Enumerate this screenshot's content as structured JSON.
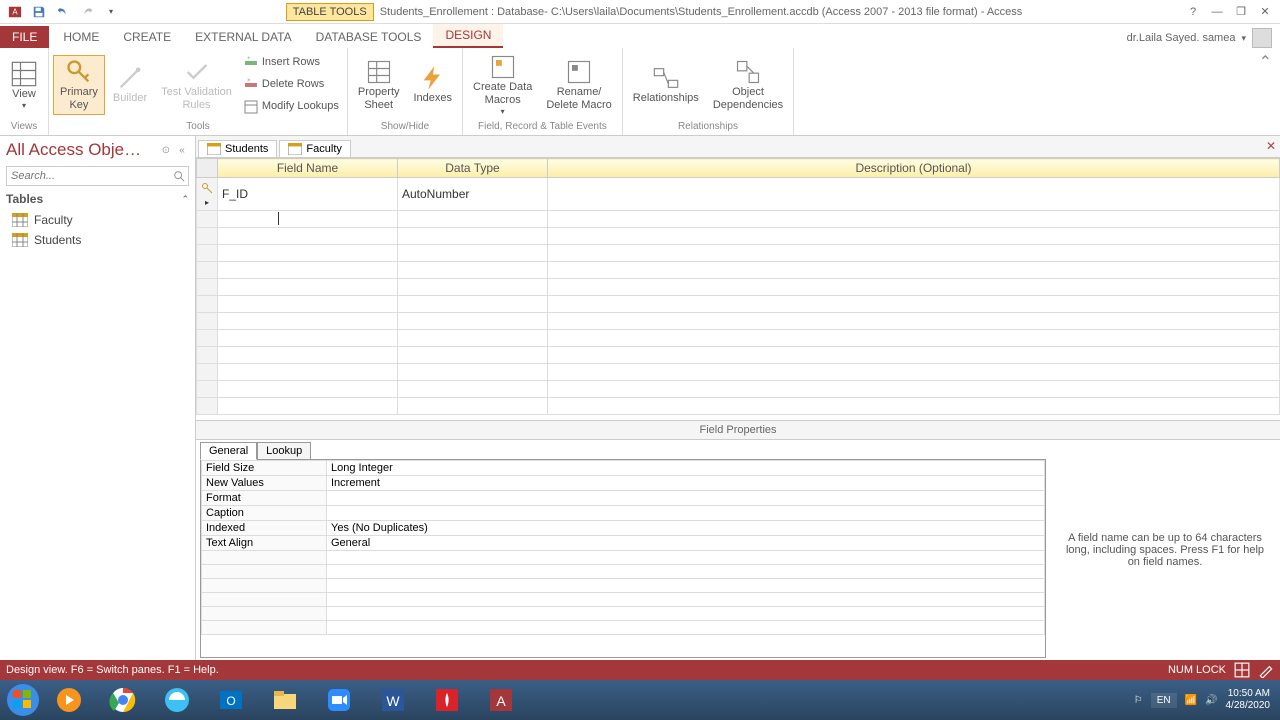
{
  "qat": {
    "app": "Access"
  },
  "title": {
    "table_tools": "TABLE TOOLS",
    "text": "Students_Enrollement : Database- C:\\Users\\laila\\Documents\\Students_Enrollement.accdb (Access 2007 - 2013 file format) - Access"
  },
  "tabs": {
    "file": "FILE",
    "home": "HOME",
    "create": "CREATE",
    "external": "EXTERNAL DATA",
    "dbtools": "DATABASE TOOLS",
    "design": "DESIGN"
  },
  "user": {
    "name": "dr.Laila Sayed. samea"
  },
  "ribbon": {
    "views": {
      "view": "View",
      "group": "Views"
    },
    "tools": {
      "primary_key": "Primary\nKey",
      "builder": "Builder",
      "test_validation": "Test Validation\nRules",
      "insert_rows": "Insert Rows",
      "delete_rows": "Delete Rows",
      "modify_lookups": "Modify Lookups",
      "group": "Tools"
    },
    "showhide": {
      "property_sheet": "Property\nSheet",
      "indexes": "Indexes",
      "group": "Show/Hide"
    },
    "events": {
      "create_macros": "Create Data\nMacros",
      "rename_delete": "Rename/\nDelete Macro",
      "group": "Field, Record & Table Events"
    },
    "relationships": {
      "relationships": "Relationships",
      "dependencies": "Object\nDependencies",
      "group": "Relationships"
    }
  },
  "nav": {
    "title": "All Access Obje…",
    "search_placeholder": "Search...",
    "tables_header": "Tables",
    "items": [
      "Faculty",
      "Students"
    ]
  },
  "doc_tabs": [
    "Students",
    "Faculty"
  ],
  "grid": {
    "headers": {
      "field_name": "Field Name",
      "data_type": "Data Type",
      "description": "Description (Optional)"
    },
    "rows": [
      {
        "pk": true,
        "name": "F_ID",
        "type": "AutoNumber",
        "desc": ""
      }
    ]
  },
  "field_props": {
    "header": "Field Properties",
    "tabs": {
      "general": "General",
      "lookup": "Lookup"
    },
    "rows": [
      {
        "label": "Field Size",
        "value": "Long Integer"
      },
      {
        "label": "New Values",
        "value": "Increment"
      },
      {
        "label": "Format",
        "value": ""
      },
      {
        "label": "Caption",
        "value": ""
      },
      {
        "label": "Indexed",
        "value": "Yes (No Duplicates)"
      },
      {
        "label": "Text Align",
        "value": "General"
      }
    ],
    "help": "A field name can be up to 64 characters long, including spaces. Press F1 for help on field names."
  },
  "status": {
    "left": "Design view.  F6 = Switch panes.  F1 = Help.",
    "numlock": "NUM LOCK"
  },
  "tray": {
    "lang": "EN",
    "time": "10:50 AM",
    "date": "4/28/2020"
  }
}
